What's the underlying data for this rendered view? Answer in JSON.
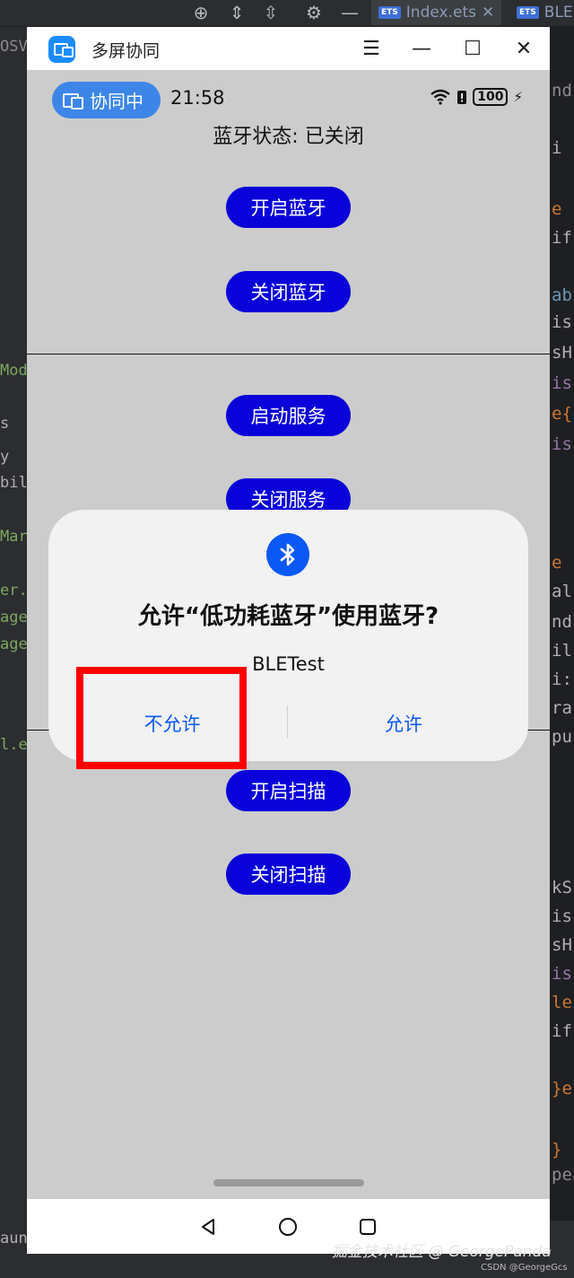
{
  "ide": {
    "tab_index": "Index.ets",
    "tab_ble": "BLE",
    "ets_badge": "ETS",
    "left_gutter": [
      {
        "text": "OSV",
        "color": "#8c8c8c"
      },
      {
        "text": "Mod",
        "color": "#7fa85f"
      },
      {
        "text": "s",
        "color": "#b0b0b0"
      },
      {
        "text": "y",
        "color": "#b0b0b0"
      },
      {
        "text": "bility",
        "color": "#b0b0b0"
      },
      {
        "text": "Mar",
        "color": "#7fa85f"
      },
      {
        "text": "er.e",
        "color": "#7fa85f"
      },
      {
        "text": "age",
        "color": "#7fa85f"
      },
      {
        "text": "age",
        "color": "#7fa85f"
      },
      {
        "text": "l.ets",
        "color": "#7fa85f"
      },
      {
        "text": "aun",
        "color": "#b0b0b0"
      }
    ],
    "right_code": [
      {
        "text": "nd",
        "color": "#8c8c8c"
      },
      {
        "text": "i",
        "color": "#b0b0b0"
      },
      {
        "text": "e",
        "color": "#cc7832"
      },
      {
        "text": "if",
        "color": "#b0b0b0"
      },
      {
        "text": "ab",
        "color": "#6897bb"
      },
      {
        "text": "is",
        "color": "#b0b0b0"
      },
      {
        "text": "sH",
        "color": "#b0b0b0"
      },
      {
        "text": "is",
        "color": "#9876aa"
      },
      {
        "text": "e{",
        "color": "#cc7832"
      },
      {
        "text": "is",
        "color": "#9876aa"
      },
      {
        "text": "e",
        "color": "#cc7832"
      },
      {
        "text": "al",
        "color": "#b0b0b0"
      },
      {
        "text": "nd",
        "color": "#b0b0b0"
      },
      {
        "text": "il",
        "color": "#b0b0b0"
      },
      {
        "text": "i:",
        "color": "#b0b0b0"
      },
      {
        "text": "ra",
        "color": "#b0b0b0"
      },
      {
        "text": "pu",
        "color": "#b0b0b0"
      },
      {
        "text": "kS",
        "color": "#b0b0b0"
      },
      {
        "text": "is",
        "color": "#b0b0b0"
      },
      {
        "text": "sH",
        "color": "#b0b0b0"
      },
      {
        "text": "is",
        "color": "#9876aa"
      },
      {
        "text": "le",
        "color": "#cc7832"
      },
      {
        "text": "if",
        "color": "#b0b0b0"
      },
      {
        "text": "}e",
        "color": "#cc7832"
      },
      {
        "text": "}",
        "color": "#cc7832"
      },
      {
        "text": "pea",
        "color": "#8c8c8c"
      }
    ]
  },
  "window": {
    "title": "多屏协同",
    "controls": {
      "menu": "☰",
      "minimize": "—",
      "maximize": "☐",
      "close": "✕"
    }
  },
  "status_bar": {
    "collab_label": "协同中",
    "time": "21:58",
    "battery": "100",
    "charging_icon": "⚡",
    "wifi_icon": "wifi-icon"
  },
  "app": {
    "bt_state": "蓝牙状态: 已关闭",
    "buttons": {
      "enable_bt": "开启蓝牙",
      "disable_bt": "关闭蓝牙",
      "start_service": "启动服务",
      "stop_service": "关闭服务",
      "start_scan": "开启扫描",
      "stop_scan": "关闭扫描"
    }
  },
  "dialog": {
    "title": "允许“低功耗蓝牙”使用蓝牙?",
    "app_name": "BLETest",
    "deny": "不允许",
    "allow": "允许"
  },
  "watermark": "掘金技术社区 @ GeorgePanda",
  "watermark_small": "CSDN @GeorgeGcs",
  "colors": {
    "accent_button": "#0a00d9",
    "dialog_action": "#0a59f7",
    "highlight": "#ff0000",
    "screen_bg": "#cccccc"
  }
}
